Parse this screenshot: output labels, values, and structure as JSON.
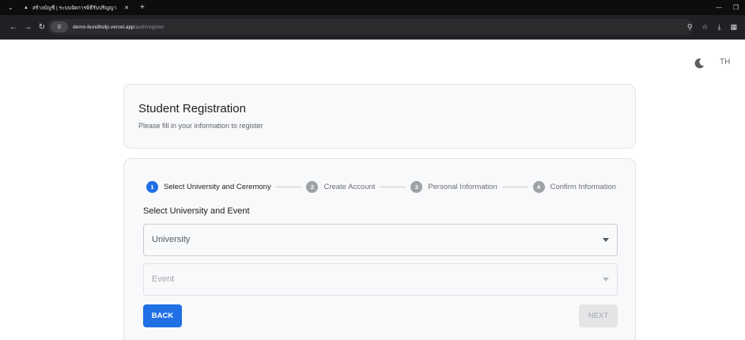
{
  "browser": {
    "tab_title": "สร้างบัญชี | ระบบจัดการพิธีรับปริญญา",
    "url_domain": "demo-bunditsilp.vercel.app",
    "url_path": "/auth/register"
  },
  "page": {
    "lang_toggle": "TH",
    "title": "Student Registration",
    "subtitle": "Please fill in your information to register"
  },
  "stepper": {
    "steps": [
      {
        "num": "1",
        "label": "Select University and Ceremony",
        "active": true
      },
      {
        "num": "2",
        "label": "Create Account",
        "active": false
      },
      {
        "num": "3",
        "label": "Personal Information",
        "active": false
      },
      {
        "num": "4",
        "label": "Confirm Information",
        "active": false
      }
    ]
  },
  "form": {
    "section_title": "Select University and Event",
    "university_placeholder": "University",
    "event_placeholder": "Event",
    "back_label": "BACK",
    "next_label": "NEXT"
  },
  "colors": {
    "primary": "#1f6fe5",
    "step_inactive": "#9ea1a6",
    "card_bg": "#f8f9fa"
  }
}
